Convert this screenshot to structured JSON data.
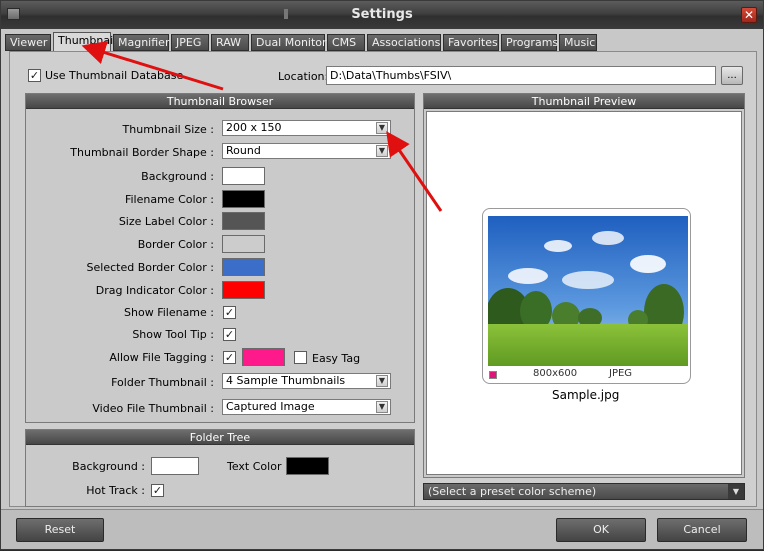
{
  "window": {
    "title": "Settings",
    "close_glyph": "✕"
  },
  "tabs": [
    {
      "label": "Viewer"
    },
    {
      "label": "Thumbnail"
    },
    {
      "label": "Magnifier"
    },
    {
      "label": "JPEG"
    },
    {
      "label": "RAW"
    },
    {
      "label": "Dual Monitor"
    },
    {
      "label": "CMS"
    },
    {
      "label": "Associations"
    },
    {
      "label": "Favorites"
    },
    {
      "label": "Programs"
    },
    {
      "label": "Music"
    }
  ],
  "top": {
    "use_db_label": "Use Thumbnail Database",
    "use_db_checked": "✓",
    "location_label": "Location:",
    "location_value": "D:\\Data\\Thumbs\\FSIV\\",
    "browse_label": "..."
  },
  "browser": {
    "header": "Thumbnail Browser",
    "thumb_size_label": "Thumbnail Size :",
    "thumb_size_value": "200 x 150",
    "border_shape_label": "Thumbnail Border Shape :",
    "border_shape_value": "Round",
    "background_label": "Background :",
    "filename_color_label": "Filename Color :",
    "size_label_color_label": "Size Label Color :",
    "border_color_label": "Border Color :",
    "selected_border_color_label": "Selected Border Color :",
    "drag_indicator_color_label": "Drag Indicator Color :",
    "show_filename_label": "Show Filename :",
    "show_tooltip_label": "Show Tool Tip :",
    "allow_tagging_label": "Allow File Tagging :",
    "easy_tag_label": "Easy Tag",
    "folder_thumb_label": "Folder Thumbnail :",
    "folder_thumb_value": "4 Sample Thumbnails",
    "video_thumb_label": "Video File Thumbnail :",
    "video_thumb_value": "Captured Image",
    "check_glyph": "✓",
    "arrow_glyph": "▼"
  },
  "colors": {
    "background": "#ffffff",
    "filename": "#000000",
    "size_label": "#555555",
    "border": "#cccccc",
    "selected_border": "#3a6ec9",
    "drag_indicator": "#ff0000",
    "tag": "#ff1a8c",
    "folder_background": "#ffffff",
    "folder_text": "#000000"
  },
  "folder_tree": {
    "header": "Folder Tree",
    "background_label": "Background :",
    "text_color_label": "Text Color :",
    "hot_track_label": "Hot Track :"
  },
  "preview": {
    "header": "Thumbnail Preview",
    "dimensions": "800x600",
    "format": "JPEG",
    "filename": "Sample.jpg",
    "preset_placeholder": "(Select a preset color scheme)"
  },
  "buttons": {
    "reset": "Reset",
    "ok": "OK",
    "cancel": "Cancel"
  }
}
